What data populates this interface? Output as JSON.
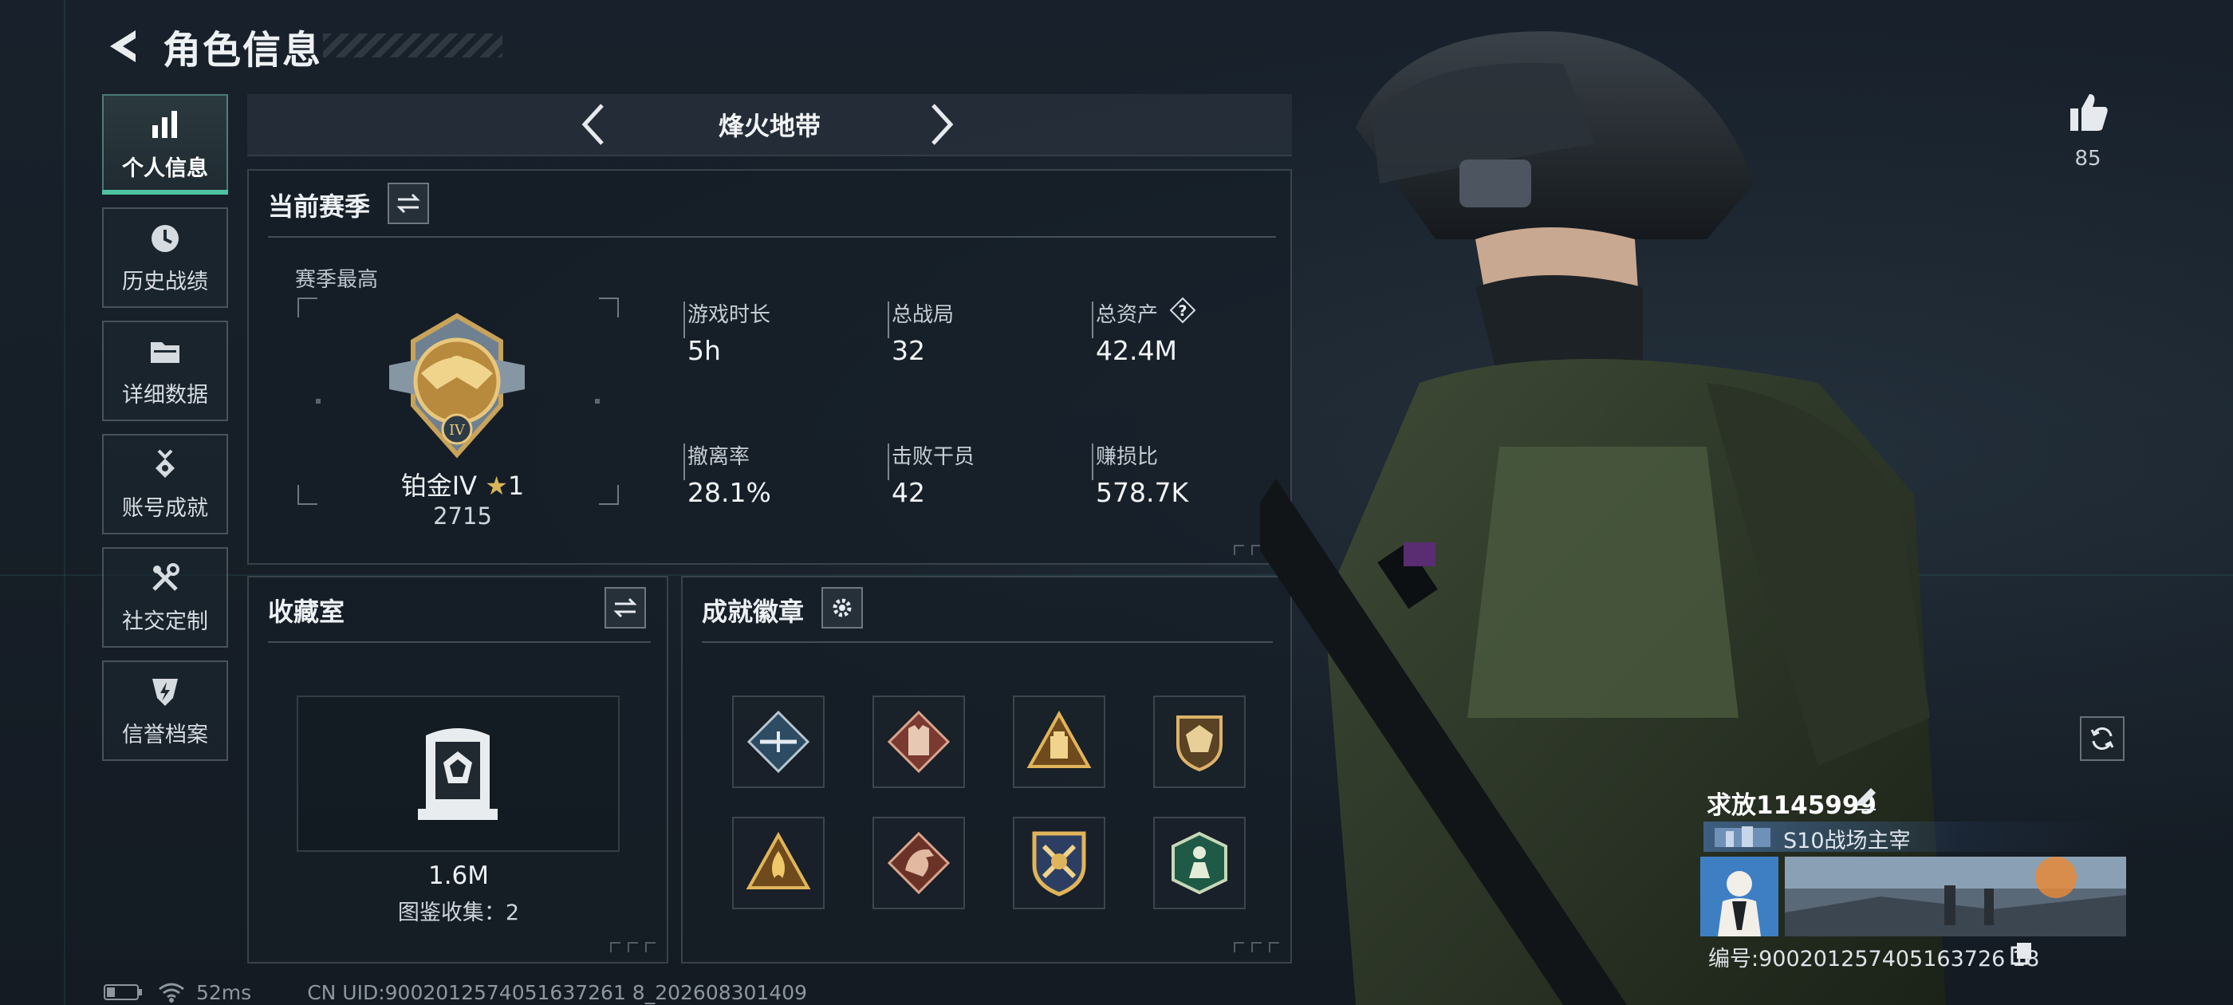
{
  "header": {
    "title": "角色信息"
  },
  "sidebar": {
    "items": [
      {
        "label": "个人信息",
        "active": true,
        "icon": "bar-chart-icon"
      },
      {
        "label": "历史战绩",
        "active": false,
        "icon": "clock-icon"
      },
      {
        "label": "详细数据",
        "active": false,
        "icon": "folder-icon"
      },
      {
        "label": "账号成就",
        "active": false,
        "icon": "medal-icon"
      },
      {
        "label": "社交定制",
        "active": false,
        "icon": "tools-icon"
      },
      {
        "label": "信誉档案",
        "active": false,
        "icon": "shield-bolt-icon"
      }
    ]
  },
  "mode_switcher": {
    "label": "烽火地带"
  },
  "current_season": {
    "title": "当前赛季",
    "best_label": "赛季最高",
    "rank": {
      "name": "铂金IV",
      "stars": "1",
      "points": "2715"
    },
    "stats": [
      {
        "label": "游戏时长",
        "value": "5h"
      },
      {
        "label": "总战局",
        "value": "32"
      },
      {
        "label": "总资产",
        "value": "42.4M",
        "help": true
      },
      {
        "label": "撤离率",
        "value": "28.1%"
      },
      {
        "label": "击败干员",
        "value": "42"
      },
      {
        "label": "赚损比",
        "value": "578.7K"
      }
    ]
  },
  "collection": {
    "title": "收藏室",
    "value": "1.6M",
    "count_label": "图鉴收集：2"
  },
  "achievements": {
    "title": "成就徽章",
    "badges": [
      "paratrooper-badge-icon",
      "armor-vest-badge-icon",
      "explosive-badge-icon",
      "dice-shield-badge-icon",
      "flame-badge-icon",
      "dragon-badge-icon",
      "crossed-weapons-badge-icon",
      "soldier-badge-icon"
    ]
  },
  "profile": {
    "likes": "85",
    "player_name": "求放1145999",
    "player_title": "S10战场主宰",
    "player_id": "编号:900201257405163726 18"
  },
  "status_bar": {
    "ping": "52ms",
    "uid": "CN UID:9002012574051637261 8_202608301409"
  },
  "colors": {
    "accent": "#4fc3a1",
    "gold": "#d8b45a",
    "background": "#151d26"
  }
}
